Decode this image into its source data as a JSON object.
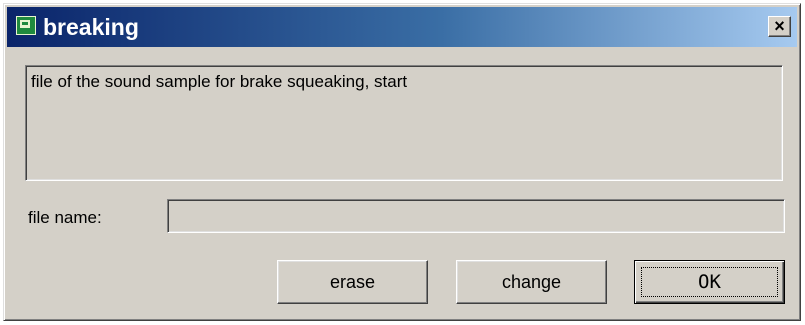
{
  "window": {
    "title": "breaking",
    "close_label": "×"
  },
  "description": {
    "text": "file of the sound sample for brake squeaking, start"
  },
  "file_name": {
    "label": "file name:",
    "value": ""
  },
  "buttons": {
    "erase": "erase",
    "change": "change",
    "ok": "OK"
  }
}
